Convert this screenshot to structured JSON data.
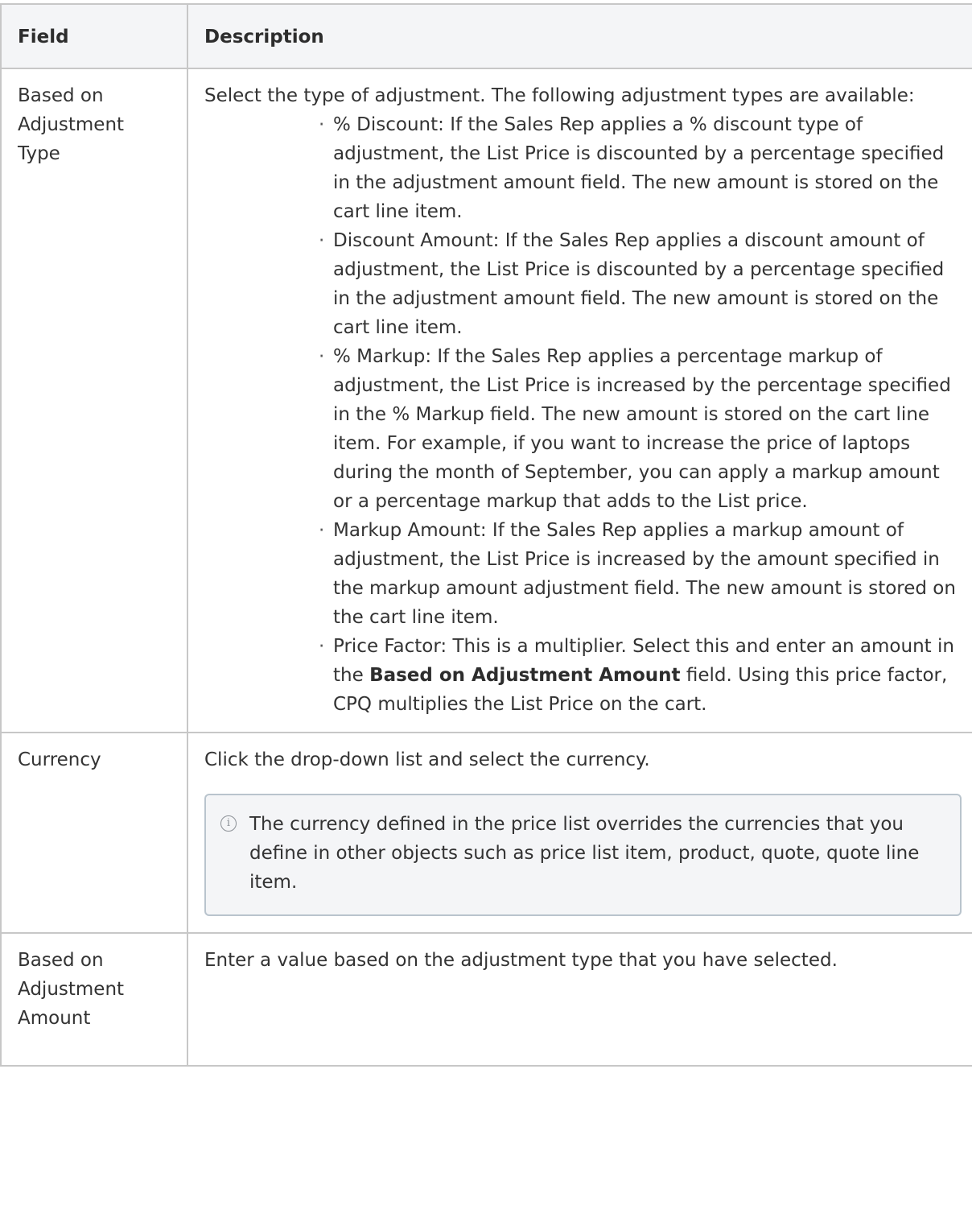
{
  "table": {
    "headers": {
      "field": "Field",
      "description": "Description"
    },
    "rows": [
      {
        "field": "Based on Adjustment Type",
        "intro": "Select the type of adjustment. The following adjustment types are available:",
        "bullets": [
          "% Discount: If the Sales Rep applies a % discount type of adjustment, the List Price is discounted by a percentage specified in the adjustment amount field. The new amount is stored on the cart line item.",
          "Discount Amount: If the Sales Rep applies a discount amount of adjustment, the List Price is discounted by a percentage specified in the adjustment amount field. The new amount is stored on the cart line item.",
          "% Markup: If the Sales Rep applies a percentage markup of adjustment, the List Price is increased by the percentage specified in the % Markup field. The new amount is stored on the cart line item. For example, if you want to increase the price of laptops during the month of September, you can apply a markup amount or a percentage markup that adds to the List price.",
          "Markup Amount: If the Sales Rep applies a markup amount of adjustment, the List Price is increased by the amount specified in the markup amount adjustment field. The new amount is stored on the cart line item."
        ],
        "last_bullet": {
          "before": "Price Factor: This is a multiplier. Select this and enter an amount in the ",
          "bold": "Based on Adjustment Amount",
          "after": " field. Using this price factor, CPQ multiplies the List Price on the cart."
        }
      },
      {
        "field": "Currency",
        "description": "Click the drop-down list and select the currency.",
        "note": "The currency defined in the price list overrides the currencies that you define in other objects such as price list item, product, quote, quote line item."
      },
      {
        "field": "Based on Adjustment Amount",
        "description": "Enter a value based on the adjustment type that you have selected."
      }
    ]
  },
  "icons": {
    "note": "info-circle-icon"
  }
}
